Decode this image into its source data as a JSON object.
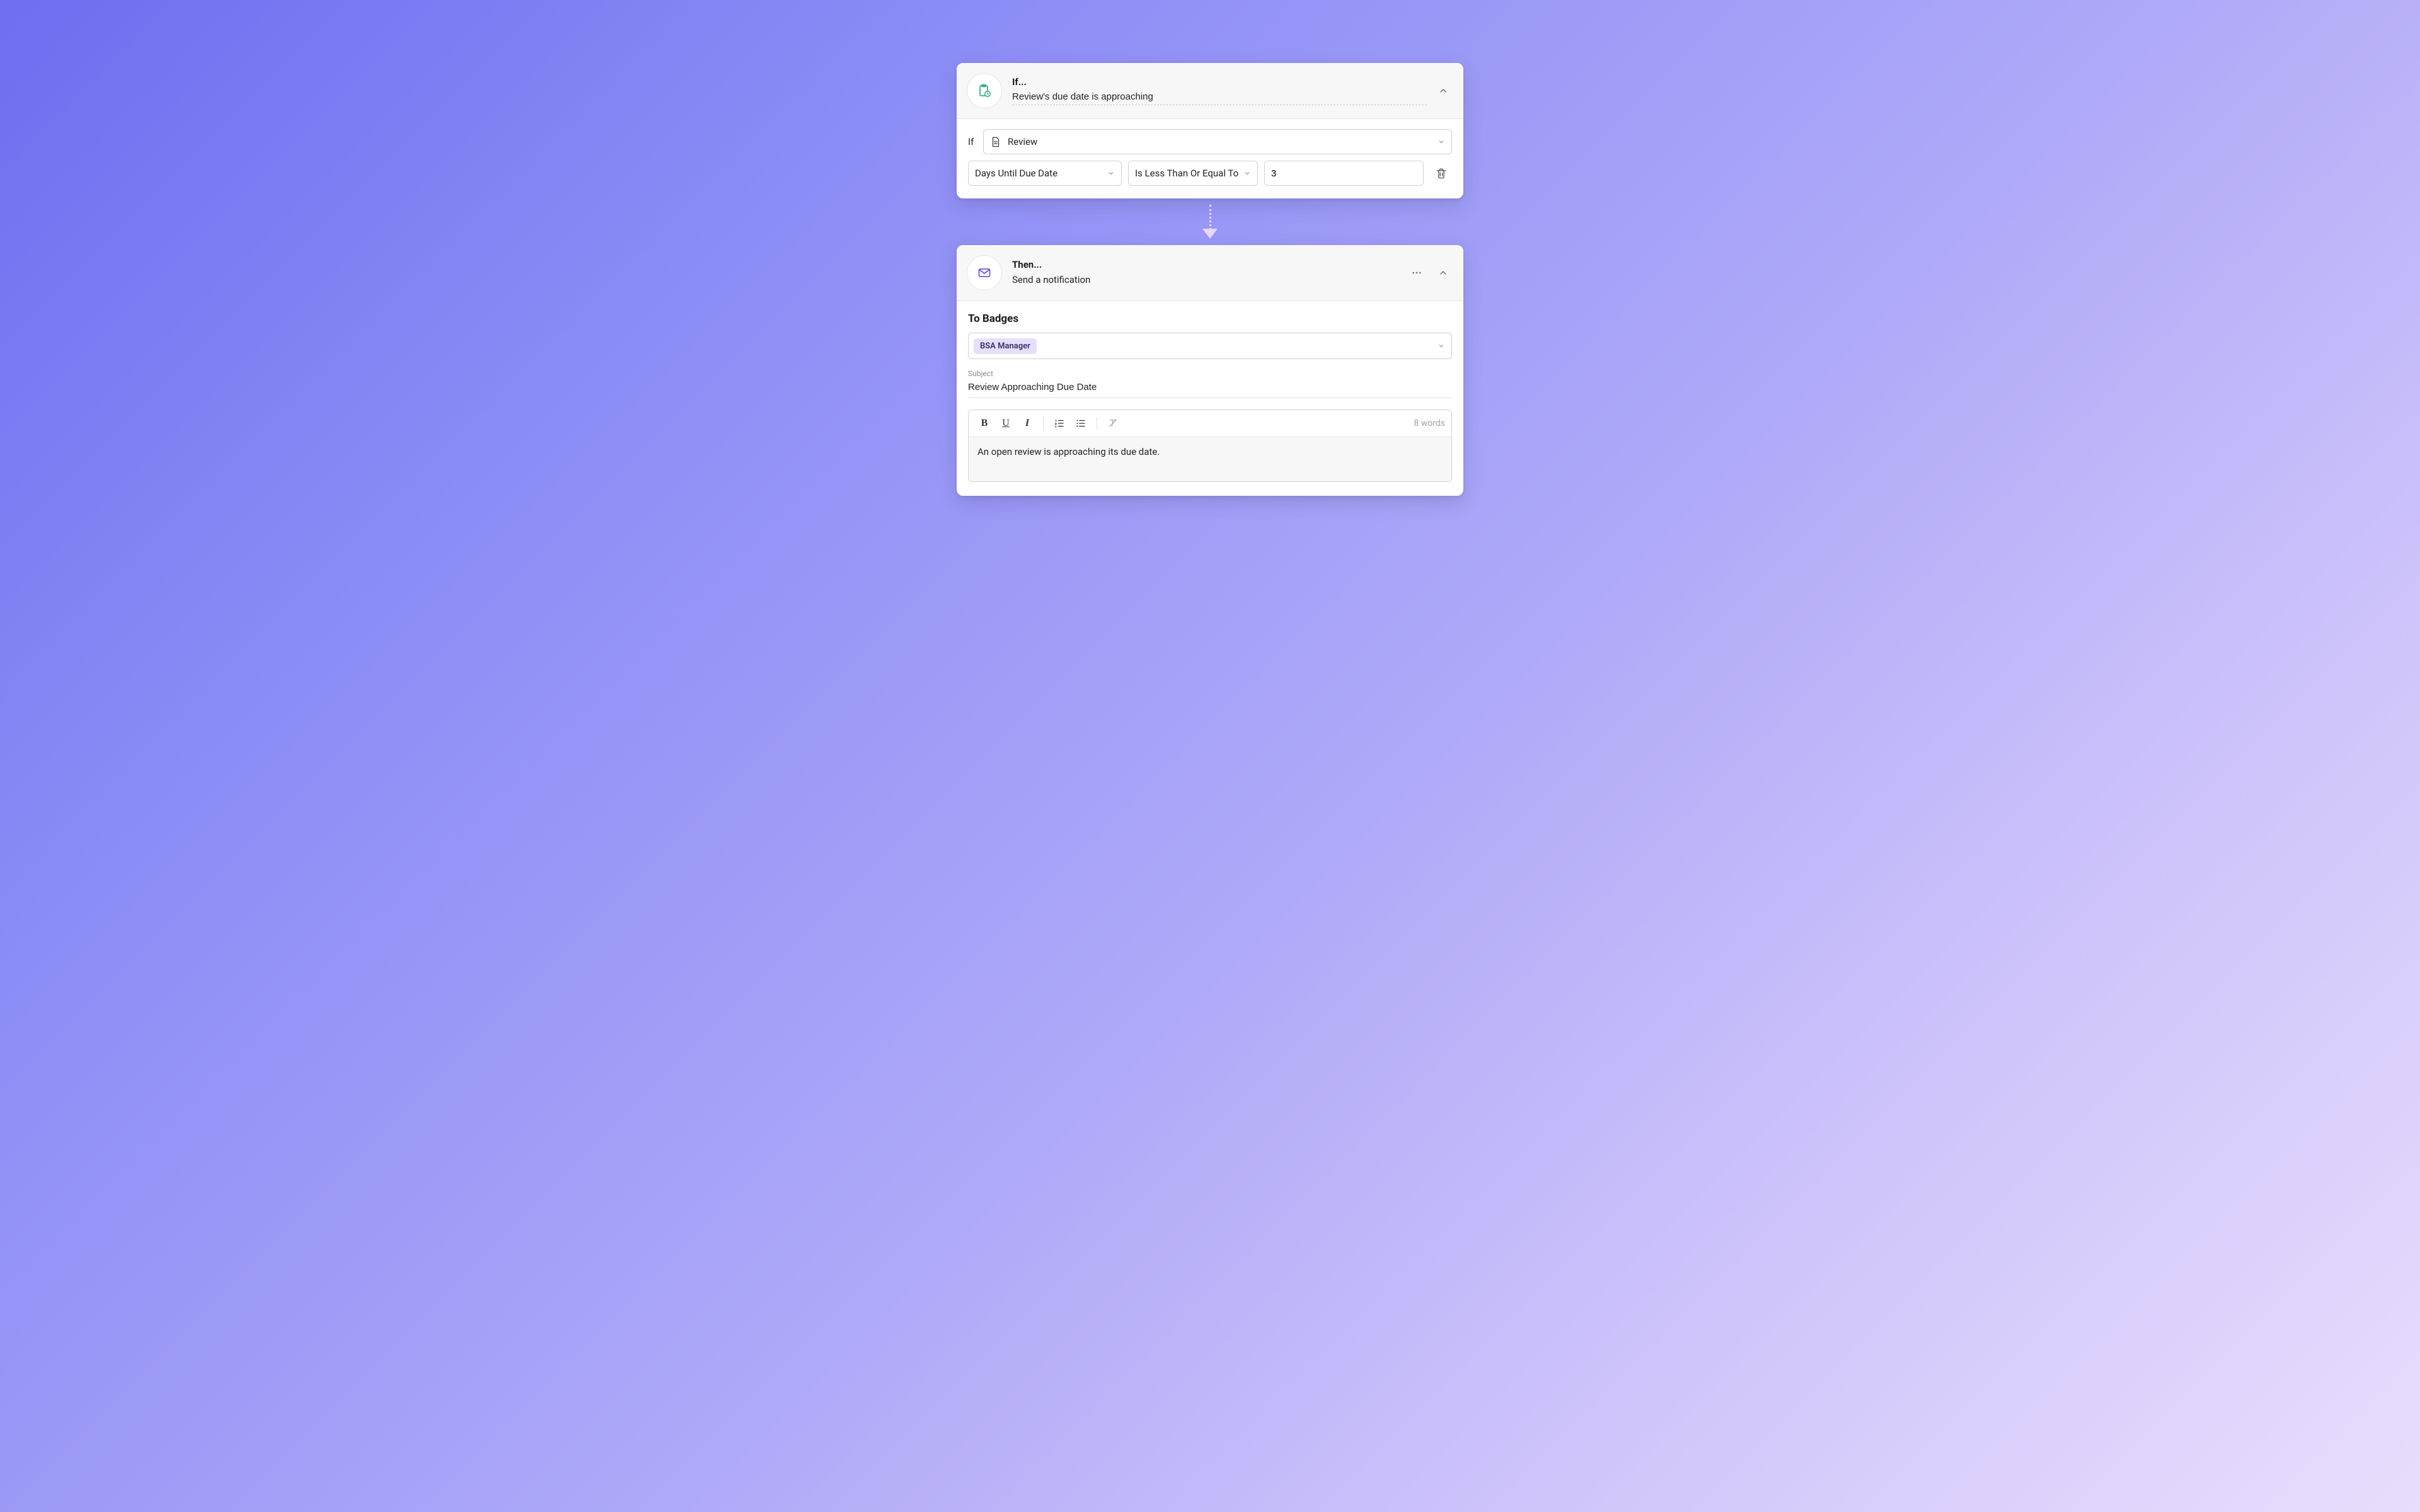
{
  "if_card": {
    "title": "If...",
    "subtitle": "Review's due date is approaching",
    "if_label": "If",
    "entity": "Review",
    "field": "Days Until Due Date",
    "operator": "Is Less Than Or Equal To",
    "value": "3"
  },
  "then_card": {
    "title": "Then...",
    "subtitle": "Send a notification",
    "to_section_label": "To Badges",
    "badges": [
      "BSA Manager"
    ],
    "subject_label": "Subject",
    "subject_value": "Review Approaching Due Date",
    "body": "An open review is approaching its due date.",
    "word_count": "8 words"
  },
  "icons": {
    "clipboard": "clipboard-clock",
    "mail": "mail"
  }
}
